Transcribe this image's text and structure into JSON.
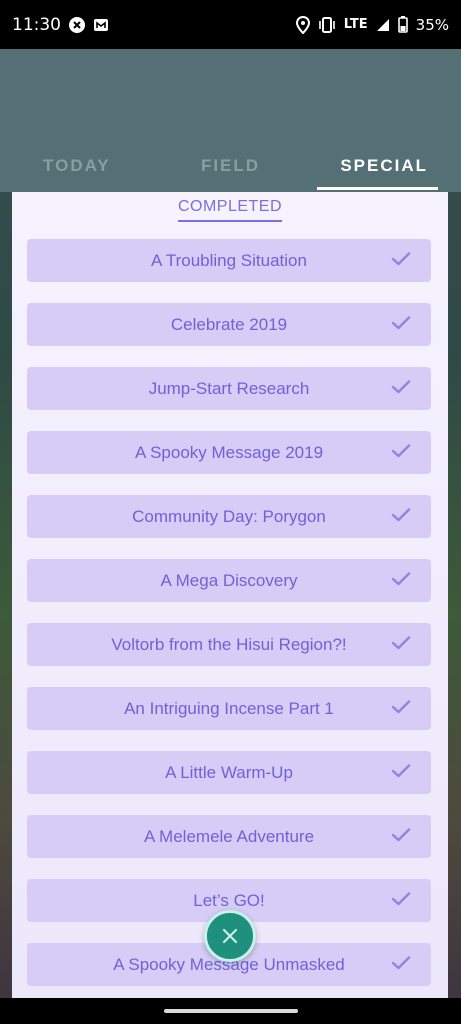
{
  "status_bar": {
    "time": "11:30",
    "network": "LTE",
    "battery": "35%",
    "icons": [
      "close-circle-icon",
      "m-app-icon",
      "location-icon",
      "vibrate-icon",
      "signal-icon",
      "battery-icon"
    ]
  },
  "tabs": [
    {
      "label": "TODAY",
      "active": false
    },
    {
      "label": "FIELD",
      "active": false
    },
    {
      "label": "SPECIAL",
      "active": true
    }
  ],
  "section": {
    "label": "COMPLETED"
  },
  "tasks": [
    {
      "title": "A Troubling Situation"
    },
    {
      "title": "Celebrate 2019"
    },
    {
      "title": "Jump-Start Research"
    },
    {
      "title": "A Spooky Message 2019"
    },
    {
      "title": "Community Day: Porygon"
    },
    {
      "title": "A Mega Discovery"
    },
    {
      "title": "Voltorb from the Hisui Region?!"
    },
    {
      "title": "An Intriguing Incense Part 1"
    },
    {
      "title": "A Little Warm-Up"
    },
    {
      "title": "A Melemele Adventure"
    },
    {
      "title": "Let’s GO!"
    },
    {
      "title": "A Spooky Message Unmasked"
    }
  ],
  "colors": {
    "header": "#557075",
    "task_bg": "#d6ccf5",
    "task_text": "#6f62d8",
    "fab": "#1f8f7e"
  }
}
